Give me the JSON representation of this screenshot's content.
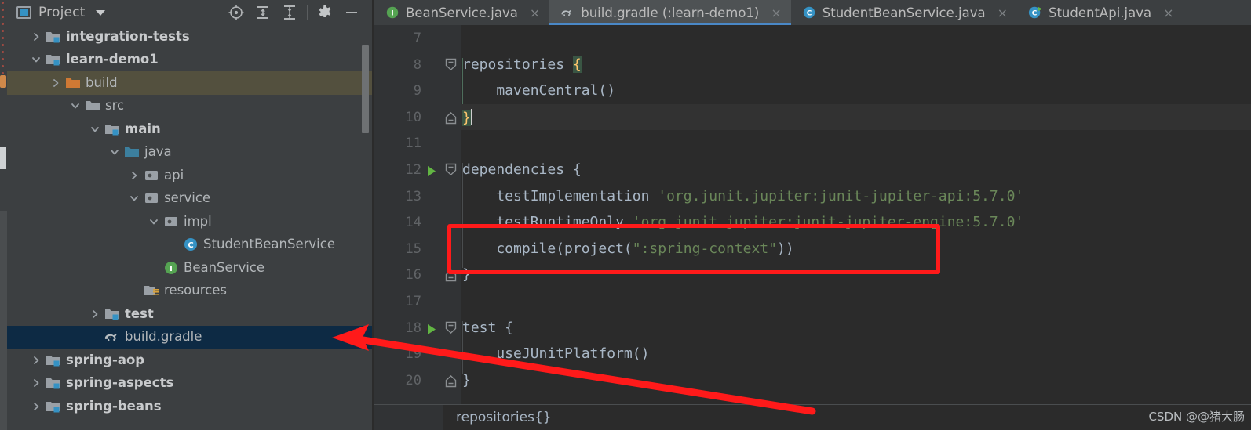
{
  "colors": {
    "accent_blue": "#4a88c7",
    "annotation_red": "#ff1a1a",
    "selection_navy": "#0d2a44",
    "selection_olive": "#53503e",
    "panel_bg": "#3c3f41",
    "editor_bg": "#2b2b2b",
    "string_green": "#6a8759",
    "brace_yellow": "#ffc66d",
    "class_icon_blue": "#3592c4",
    "interface_icon_green": "#55a352",
    "folder_orange": "#d0894a"
  },
  "panel": {
    "title": "Project",
    "dropdown_caret": "chevron-down-icon",
    "tools": [
      {
        "name": "locate-icon",
        "label": "Select Opened File"
      },
      {
        "name": "expand-all-icon",
        "label": "Expand All"
      },
      {
        "name": "collapse-all-icon",
        "label": "Collapse All"
      },
      {
        "name": "gear-icon",
        "label": "Settings"
      },
      {
        "name": "minimize-icon",
        "label": "Hide"
      }
    ]
  },
  "tree": {
    "items": [
      {
        "label": "integration-tests",
        "indent": 1,
        "twisty": "right",
        "icon": "module-folder-icon",
        "bold": true,
        "state": "normal"
      },
      {
        "label": "learn-demo1",
        "indent": 1,
        "twisty": "down",
        "icon": "module-folder-icon",
        "bold": true,
        "state": "normal"
      },
      {
        "label": "build",
        "indent": 2,
        "twisty": "right",
        "icon": "excluded-folder-icon",
        "bold": false,
        "state": "hover"
      },
      {
        "label": "src",
        "indent": 3,
        "twisty": "down",
        "icon": "folder-icon",
        "bold": false,
        "state": "normal"
      },
      {
        "label": "main",
        "indent": 4,
        "twisty": "down",
        "icon": "module-folder-icon",
        "bold": true,
        "state": "normal"
      },
      {
        "label": "java",
        "indent": 5,
        "twisty": "down",
        "icon": "source-root-folder-icon",
        "bold": false,
        "state": "normal"
      },
      {
        "label": "api",
        "indent": 6,
        "twisty": "right",
        "icon": "package-icon",
        "bold": false,
        "state": "normal"
      },
      {
        "label": "service",
        "indent": 6,
        "twisty": "down",
        "icon": "package-icon",
        "bold": false,
        "state": "normal"
      },
      {
        "label": "impl",
        "indent": 7,
        "twisty": "down",
        "icon": "package-icon",
        "bold": false,
        "state": "normal"
      },
      {
        "label": "StudentBeanService",
        "indent": 8,
        "twisty": "none",
        "icon": "class-icon",
        "bold": false,
        "state": "normal"
      },
      {
        "label": "BeanService",
        "indent": 7,
        "twisty": "none",
        "icon": "interface-icon",
        "bold": false,
        "state": "normal"
      },
      {
        "label": "resources",
        "indent": 6,
        "twisty": "none",
        "icon": "resources-folder-icon",
        "bold": false,
        "state": "normal"
      },
      {
        "label": "test",
        "indent": 4,
        "twisty": "right",
        "icon": "module-folder-icon",
        "bold": true,
        "state": "normal"
      },
      {
        "label": "build.gradle",
        "indent": 4,
        "twisty": "none",
        "icon": "gradle-icon",
        "bold": false,
        "state": "selected"
      },
      {
        "label": "spring-aop",
        "indent": 1,
        "twisty": "right",
        "icon": "module-folder-icon",
        "bold": true,
        "state": "normal"
      },
      {
        "label": "spring-aspects",
        "indent": 1,
        "twisty": "right",
        "icon": "module-folder-icon",
        "bold": true,
        "state": "normal"
      },
      {
        "label": "spring-beans",
        "indent": 1,
        "twisty": "right",
        "icon": "module-folder-icon",
        "bold": true,
        "state": "normal"
      }
    ]
  },
  "tabs": [
    {
      "label": "BeanService.java",
      "icon": "interface-icon",
      "active": false,
      "close": "×"
    },
    {
      "label": "build.gradle (:learn-demo1)",
      "icon": "gradle-icon",
      "active": true,
      "close": "×"
    },
    {
      "label": "StudentBeanService.java",
      "icon": "class-icon",
      "active": false,
      "close": "×"
    },
    {
      "label": "StudentApi.java",
      "icon": "runnable-class-icon",
      "active": false,
      "close": "×"
    }
  ],
  "editor": {
    "lines": [
      {
        "num": "7",
        "text": "",
        "fold": "none",
        "run": false,
        "caret_line": false
      },
      {
        "num": "8",
        "text": "repositories {",
        "fold": "open",
        "run": false,
        "caret_line": false,
        "brace_hl": "open"
      },
      {
        "num": "9",
        "text": "    mavenCentral()",
        "fold": "none",
        "run": false,
        "caret_line": false
      },
      {
        "num": "10",
        "text": "}",
        "fold": "close",
        "run": false,
        "caret_line": true,
        "brace_hl": "close"
      },
      {
        "num": "11",
        "text": "",
        "fold": "none",
        "run": false,
        "caret_line": false
      },
      {
        "num": "12",
        "text": "dependencies {",
        "fold": "open",
        "run": true,
        "caret_line": false
      },
      {
        "num": "13",
        "text": "    testImplementation 'org.junit.jupiter:junit-jupiter-api:5.7.0'",
        "fold": "none",
        "run": false,
        "caret_line": false
      },
      {
        "num": "14",
        "text": "    testRuntimeOnly 'org.junit.jupiter:junit-jupiter-engine:5.7.0'",
        "fold": "none",
        "run": false,
        "caret_line": false
      },
      {
        "num": "15",
        "text": "    compile(project(\":spring-context\"))",
        "fold": "none",
        "run": false,
        "caret_line": false
      },
      {
        "num": "16",
        "text": "}",
        "fold": "close",
        "run": false,
        "caret_line": false
      },
      {
        "num": "17",
        "text": "",
        "fold": "none",
        "run": false,
        "caret_line": false
      },
      {
        "num": "18",
        "text": "test {",
        "fold": "open",
        "run": true,
        "caret_line": false
      },
      {
        "num": "19",
        "text": "    useJUnitPlatform()",
        "fold": "none",
        "run": false,
        "caret_line": false
      },
      {
        "num": "20",
        "text": "}",
        "fold": "close",
        "run": false,
        "caret_line": false
      }
    ],
    "breadcrumb": "repositories{}"
  },
  "annotations": {
    "highlight_box_target": "compile(project(\":spring-context\"))",
    "arrow_target": "build.gradle"
  },
  "watermark": "CSDN @@猪大肠"
}
